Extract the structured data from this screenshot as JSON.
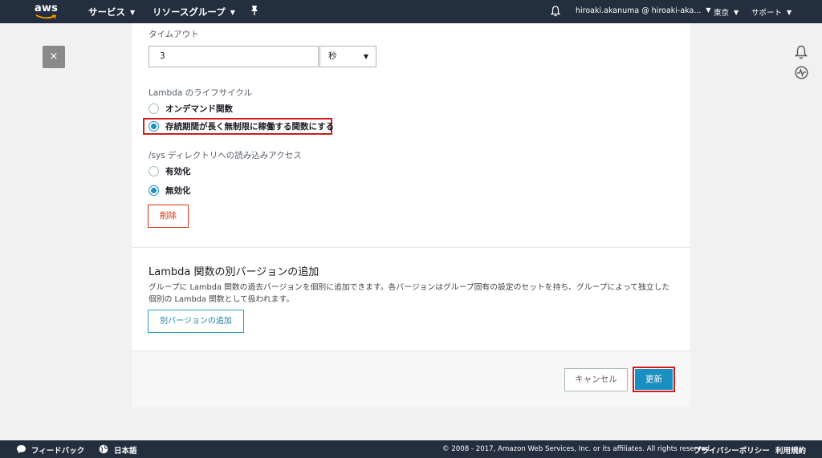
{
  "topbar": {
    "logo_text": "aws",
    "services": "サービス",
    "resource_groups": "リソースグループ",
    "user": "hiroaki.akanuma @ hiroaki-aka...",
    "region": "東京",
    "support": "サポート"
  },
  "close_label": "×",
  "timeout": {
    "label": "タイムアウト",
    "value": "3",
    "unit": "秒"
  },
  "lifecycle": {
    "label": "Lambda のライフサイクル",
    "options": [
      {
        "label": "オンデマンド関数",
        "selected": false
      },
      {
        "label": "存続期間が長く無制限に稼働する関数にする",
        "selected": true
      }
    ]
  },
  "sys_access": {
    "label": "/sys ディレクトリへの読み込みアクセス",
    "options": [
      {
        "label": "有効化",
        "selected": false
      },
      {
        "label": "無効化",
        "selected": true
      }
    ]
  },
  "delete_label": "削除",
  "versions": {
    "title": "Lambda 関数の別バージョンの追加",
    "description": "グループに Lambda 関数の過去バージョンを個別に追加できます。各バージョンはグループ固有の設定のセットを持ち、グループによって独立した個別の Lambda 関数として扱われます。",
    "add_label": "別バージョンの追加"
  },
  "actions": {
    "cancel": "キャンセル",
    "update": "更新"
  },
  "footer": {
    "feedback": "フィードバック",
    "language": "日本語",
    "copyright": "© 2008 - 2017, Amazon Web Services, Inc. or its affiliates. All rights reserved.",
    "privacy": "プライバシーポリシー",
    "terms": "利用規約"
  },
  "colors": {
    "nav_bg": "#232f3e",
    "accent": "#1a8fc1",
    "highlight": "#d01c1c",
    "danger": "#d13212"
  }
}
